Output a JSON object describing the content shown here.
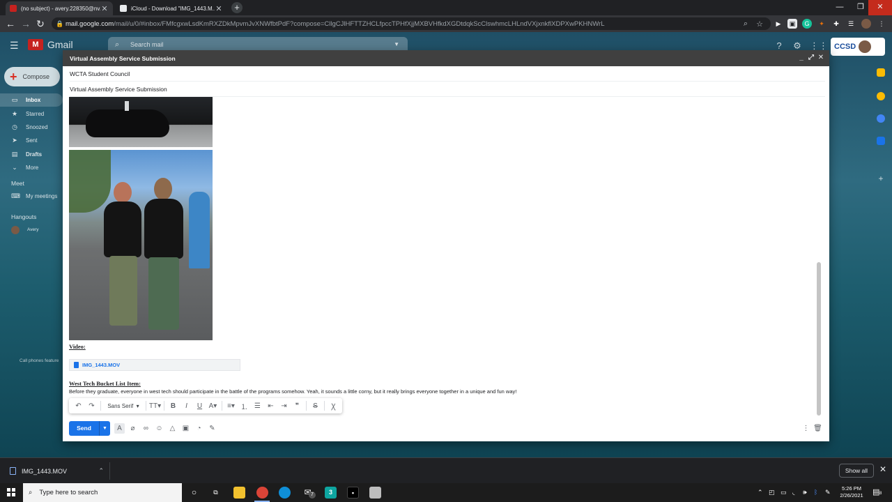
{
  "browser": {
    "tabs": [
      {
        "title": "(no subject) - avery.228350@nv...",
        "active": true
      },
      {
        "title": "iCloud - Download \"IMG_1443.M...",
        "active": false
      }
    ],
    "url_host": "mail.google.com",
    "url_path": "/mail/u/0/#inbox/FMfcgxwLsdKmRXZDkMpvmJvXNWfbtPdF?compose=CllgCJlHFTTZHCLfpccTPHfXjjMXBVHfkdXGDtdqkScClswhmcLHLndVXjxnkflXDPXwPKHNWrL"
  },
  "gmail": {
    "app_name": "Gmail",
    "search_placeholder": "Search mail",
    "org_logo": "CCSD",
    "compose_label": "Compose",
    "nav": [
      {
        "label": "Inbox",
        "icon": "inbox-icon",
        "active": true
      },
      {
        "label": "Starred",
        "icon": "star-icon"
      },
      {
        "label": "Snoozed",
        "icon": "clock-icon"
      },
      {
        "label": "Sent",
        "icon": "send-icon"
      },
      {
        "label": "Drafts",
        "icon": "draft-icon"
      },
      {
        "label": "More",
        "icon": "chevron-down-icon"
      }
    ],
    "meet_label": "Meet",
    "my_meetings": "My meetings",
    "hangouts_label": "Hangouts",
    "hangouts_user": "Avery",
    "phone_note": "Call phones feature"
  },
  "compose": {
    "title": "Virtual Assembly Service Submission",
    "to": "WCTA Student Council",
    "subject": "Virtual Assembly Service Submission",
    "video_label": "Video:",
    "attachment_name": "IMG_1443.MOV",
    "bucket_label": "West Tech Bucket List Item:",
    "body_text": "Before they graduate, everyone in west tech should participate in the battle of the programs somehow. Yeah, it sounds a little corny, but it really brings everyone together in a unique and fun way!",
    "font_name": "Sans Serif",
    "send_label": "Send"
  },
  "downloads": {
    "file_name": "IMG_1443.MOV",
    "show_all": "Show all"
  },
  "taskbar": {
    "search_placeholder": "Type here to search",
    "mail_badge": "7",
    "time": "5:26 PM",
    "date": "2/26/2021",
    "notif_count": "8"
  },
  "colors": {
    "accent": "#1a73e8",
    "compose_header": "#404040",
    "chrome_dark": "#202124"
  }
}
